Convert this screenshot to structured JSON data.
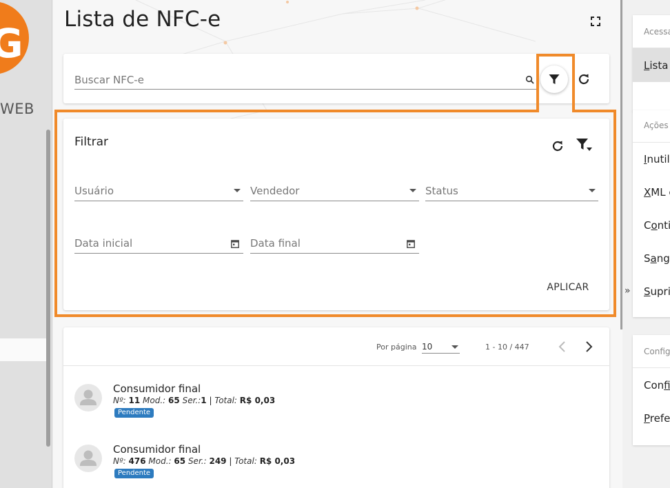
{
  "left_sidebar": {
    "logo_letter": "G",
    "logo_text": "WEB"
  },
  "main": {
    "title": "Lista de NFC-e",
    "search": {
      "placeholder": "Buscar NFC-e"
    },
    "filter": {
      "title": "Filtrar",
      "fields": {
        "user": "Usuário",
        "seller": "Vendedor",
        "status": "Status",
        "start_date": "Data inicial",
        "end_date": "Data final"
      },
      "apply_label": "APLICAR"
    },
    "pager": {
      "per_page_label": "Por página",
      "per_page_value": "10",
      "range": "1 - 10 / 447"
    },
    "items": [
      {
        "name": "Consumidor final",
        "number_label": "Nº:",
        "number": "11",
        "model_label": "Mod.:",
        "model": "65",
        "series_label": "Ser.:",
        "series": "1",
        "separator": "|",
        "total_label": "Total:",
        "total": "R$ 0,03",
        "status": "Pendente"
      },
      {
        "name": "Consumidor final",
        "number_label": "Nº:",
        "number": "476",
        "model_label": "Mod.:",
        "model": "65",
        "series_label": "Ser.:",
        "series": "249",
        "separator": "|",
        "total_label": "Total:",
        "total": "R$ 0,03",
        "status": "Pendente"
      }
    ]
  },
  "right_panel": {
    "section1_header": "Acessa",
    "section1_items": [
      {
        "access_key": "L",
        "rest": "ista"
      }
    ],
    "section2_header": "Ações",
    "section2_items": [
      {
        "prefix": "",
        "access_key": "I",
        "rest": "nutil"
      },
      {
        "prefix": "",
        "access_key": "X",
        "rest": "ML c"
      },
      {
        "prefix": "C",
        "access_key": "o",
        "rest": "nti"
      },
      {
        "prefix": "S",
        "access_key": "a",
        "rest": "ngr"
      },
      {
        "prefix": "",
        "access_key": "S",
        "rest": "upri"
      }
    ],
    "collapse_arrow": "»",
    "section3_header": "Config",
    "section3_items": [
      {
        "prefix": "Con",
        "access_key": "f",
        "rest": "i"
      },
      {
        "prefix": "",
        "access_key": "P",
        "rest": "refe"
      }
    ]
  },
  "colors": {
    "accent_orange": "#f07c1b",
    "badge_blue": "#2d7bbf",
    "highlight_outline": "#f08a2a"
  }
}
